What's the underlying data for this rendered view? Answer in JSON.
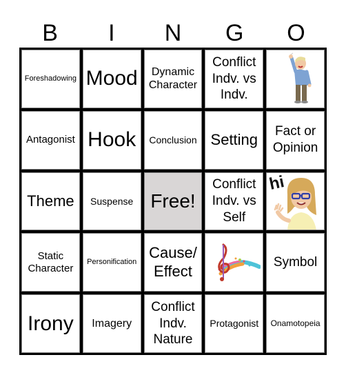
{
  "header": {
    "letters": [
      "B",
      "I",
      "N",
      "G",
      "O"
    ]
  },
  "grid": {
    "cells": [
      {
        "text": "Foreshadowing"
      },
      {
        "text": "Mood"
      },
      {
        "text": "Dynamic Character"
      },
      {
        "text": "Conflict Indv. vs Indv."
      },
      {
        "image": "man-waving-avatar"
      },
      {
        "text": "Antagonist"
      },
      {
        "text": "Hook"
      },
      {
        "text": "Conclusion"
      },
      {
        "text": "Setting"
      },
      {
        "text": "Fact or Opinion"
      },
      {
        "text": "Theme"
      },
      {
        "text": "Suspense"
      },
      {
        "text": "Free!"
      },
      {
        "text": "Conflict Indv. vs Self"
      },
      {
        "image": "woman-waving-hi-avatar",
        "caption": "hi"
      },
      {
        "text": "Static Character"
      },
      {
        "text": "Personification"
      },
      {
        "text": "Cause/ Effect"
      },
      {
        "image": "colorful-treble-clef"
      },
      {
        "text": "Symbol"
      },
      {
        "text": "Irony"
      },
      {
        "text": "Imagery"
      },
      {
        "text": "Conflict Indv. Nature"
      },
      {
        "text": "Protagonist"
      },
      {
        "text": "Onamotopeia"
      }
    ]
  },
  "colors": {
    "free_cell": "#d9d6d6",
    "border": "#000000"
  }
}
